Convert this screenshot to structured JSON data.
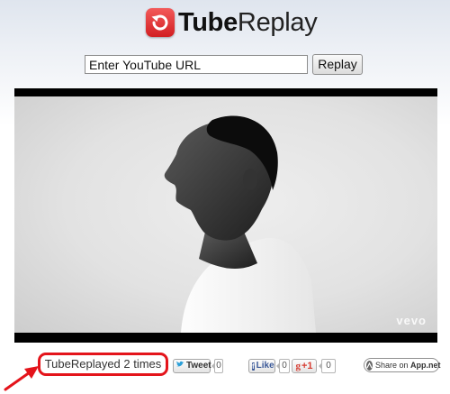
{
  "header": {
    "logo_icon": "replay-icon",
    "logo_bold": "Tube",
    "logo_light": "Replay",
    "brand_color": "#e02626"
  },
  "url_form": {
    "placeholder": "Enter YouTube URL",
    "button_label": "Replay"
  },
  "player": {
    "watermark": "vevo"
  },
  "footer": {
    "replay_count_text": "TubeReplayed 2 times",
    "highlight_color": "#e4141b",
    "tweet": {
      "label": "Tweet",
      "count": "0",
      "icon": "twitter-bird-icon"
    },
    "facebook": {
      "label": "Like",
      "count": "0",
      "icon": "facebook-f-icon"
    },
    "gplus": {
      "label": "+1",
      "count": "0",
      "icon": "google-plus-icon"
    },
    "appnet": {
      "label_prefix": "Share on ",
      "label_bold": "App.net",
      "icon": "appnet-icon"
    }
  }
}
